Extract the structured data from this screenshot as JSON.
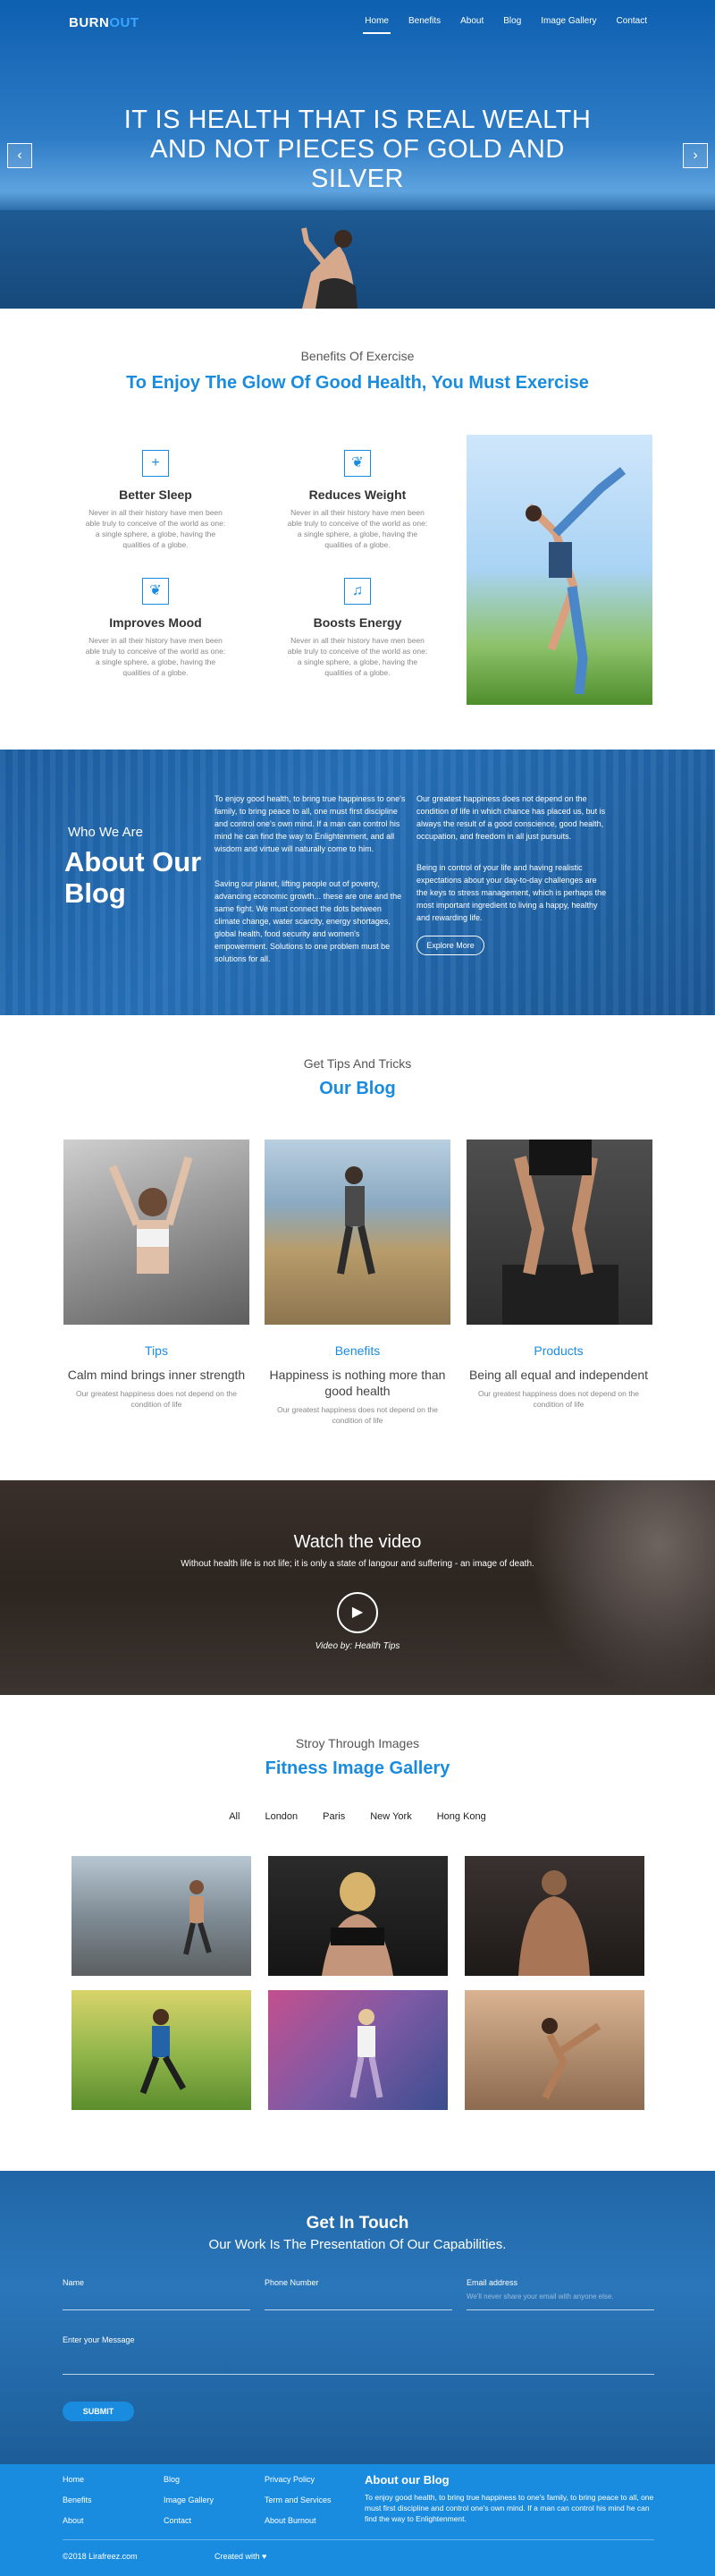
{
  "nav": {
    "logo_main": "BURN",
    "logo_accent": "OUT",
    "items": [
      {
        "label": "Home",
        "active": true
      },
      {
        "label": "Benefits"
      },
      {
        "label": "About"
      },
      {
        "label": "Blog"
      },
      {
        "label": "Image Gallery"
      },
      {
        "label": "Contact"
      }
    ]
  },
  "hero": {
    "title": "IT IS HEALTH THAT IS REAL WEALTH AND NOT PIECES OF GOLD AND SILVER",
    "prev_icon": "chevron-left-icon",
    "next_icon": "chevron-right-icon"
  },
  "benefits": {
    "subtitle": "Benefits Of Exercise",
    "title": "To Enjoy The Glow Of Good Health, You Must Exercise",
    "items": [
      {
        "icon": "plus-icon",
        "title": "Better Sleep",
        "text": "Never in all their history have men been able truly to conceive of the world as one: a single sphere, a globe, having the qualities of a globe."
      },
      {
        "icon": "leaf-icon",
        "title": "Reduces Weight",
        "text": "Never in all their history have men been able truly to conceive of the world as one: a single sphere, a globe, having the qualities of a globe."
      },
      {
        "icon": "leaf-icon",
        "title": "Improves Mood",
        "text": "Never in all their history have men been able truly to conceive of the world as one: a single sphere, a globe, having the qualities of a globe."
      },
      {
        "icon": "bell-icon",
        "title": "Boosts Energy",
        "text": "Never in all their history have men been able truly to conceive of the world as one: a single sphere, a globe, having the qualities of a globe."
      }
    ]
  },
  "about": {
    "kicker": "Who We Are",
    "title": "About Our Blog",
    "para1": "To enjoy good health, to bring true happiness to one's family, to bring peace to all, one must first discipline and control one's own mind. If a man can control his mind he can find the way to Enlightenment, and all wisdom and virtue will naturally come to him.",
    "para2": "Saving our planet, lifting people out of poverty, advancing economic growth... these are one and the same fight. We must connect the dots between climate change, water scarcity, energy shortages, global health, food security and women's empowerment. Solutions to one problem must be solutions for all.",
    "para3": "Our greatest happiness does not depend on the condition of life in which chance has placed us, but is always the result of a good conscience, good health, occupation, and freedom in all just pursuits.",
    "para4": "Being in control of your life and having realistic expectations about your day-to-day challenges are the keys to stress management, which is perhaps the most important ingredient to living a happy, healthy and rewarding life.",
    "button": "Explore More"
  },
  "blog": {
    "subtitle": "Get Tips And Tricks",
    "title": "Our Blog",
    "posts": [
      {
        "category": "Tips",
        "title": "Calm mind brings inner strength",
        "text": "Our greatest happiness does not depend on the condition of life"
      },
      {
        "category": "Benefits",
        "title": "Happiness is nothing more than good health",
        "text": "Our greatest happiness does not depend on the condition of life"
      },
      {
        "category": "Products",
        "title": "Being all equal and independent",
        "text": "Our greatest happiness does not depend on the condition of life"
      }
    ]
  },
  "video": {
    "title": "Watch the video",
    "subtitle": "Without health life is not life; it is only a state of langour and suffering - an image of death.",
    "credit": "Video by: Health Tips",
    "play_icon": "play-icon"
  },
  "gallery": {
    "subtitle": "Stroy Through Images",
    "title": "Fitness Image Gallery",
    "filters": [
      "All",
      "London",
      "Paris",
      "New York",
      "Hong Kong"
    ]
  },
  "contact": {
    "title": "Get In Touch",
    "subtitle": "Our Work Is The Presentation Of Our Capabilities.",
    "name_label": "Name",
    "phone_label": "Phone Number",
    "email_label": "Email address",
    "email_hint": "We'll never share your email with anyone else.",
    "message_label": "Enter your Message",
    "submit": "SUBMIT"
  },
  "footer": {
    "col1": [
      "Home",
      "Benefits",
      "About"
    ],
    "col2": [
      "Blog",
      "Image Gallery",
      "Contact"
    ],
    "col3": [
      "Privacy Policy",
      "Term and Services",
      "About Burnout"
    ],
    "about_title": "About our Blog",
    "about_text": "To enjoy good health, to bring true happiness to one's family, to bring peace to all, one must first discipline and control one's own mind. If a man can control his mind he can find the way to Enlightenment.",
    "copyright": "©2018 Lirafreez.com",
    "created": "Created with",
    "heart_icon": "heart-icon"
  },
  "colors": {
    "accent": "#1a8ce0",
    "hero_blue": "#0d5fb0",
    "footer": "#1a8ce0"
  }
}
